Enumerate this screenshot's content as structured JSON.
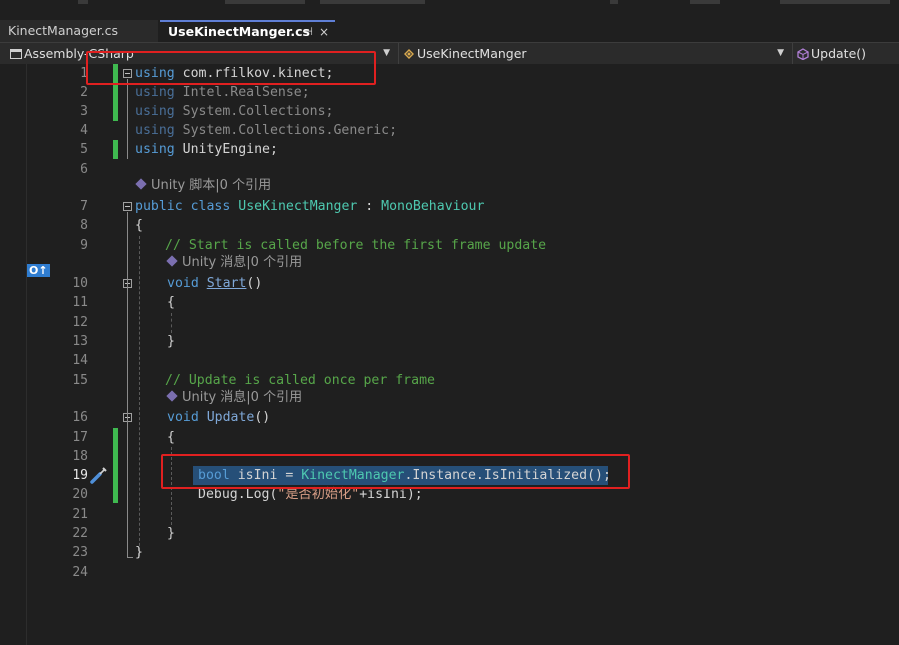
{
  "tabs": {
    "inactive_label": "KinectManager.cs",
    "active_label": "UseKinectManger.cs",
    "pin_glyph": "⊣",
    "close_glyph": "×"
  },
  "navbar": {
    "project": "Assembly-CSharp",
    "type": "UseKinectManger",
    "member": "Update()"
  },
  "editor": {
    "line_numbers": [
      "1",
      "2",
      "3",
      "4",
      "5",
      "6",
      "7",
      "8",
      "9",
      "10",
      "11",
      "12",
      "13",
      "14",
      "15",
      "16",
      "17",
      "18",
      "19",
      "20",
      "21",
      "22",
      "23",
      "24"
    ],
    "current_line": "19",
    "lines": {
      "l1": {
        "kw": "using",
        "rest": " com.rfilkov.kinect;"
      },
      "l2": {
        "kw": "using",
        "rest": " Intel.RealSense;"
      },
      "l3": {
        "kw": "using",
        "rest": " System.Collections;"
      },
      "l4": {
        "kw": "using",
        "rest": " System.Collections.Generic;"
      },
      "l5": {
        "kw": "using",
        "rest": " UnityEngine;"
      },
      "l7": {
        "kw1": "public",
        "kw2": "class",
        "name": "UseKinectManger",
        "sep": " : ",
        "base": "MonoBehaviour"
      },
      "l8": "{",
      "l9": "// Start is called before the first frame update",
      "l10": {
        "kw": "void",
        "name": "Start",
        "paren": "()"
      },
      "l11": "{",
      "l13": "}",
      "l15": "// Update is called once per frame",
      "l16": {
        "kw": "void",
        "name": "Update",
        "paren": "()"
      },
      "l17": "{",
      "l19": {
        "kw": "bool",
        "var": " isIni = ",
        "cls": "KinectManager",
        "rest": ".Instance.IsInitialized();"
      },
      "l20": {
        "a": "Debug.Log(",
        "str": "\"是否初始化\"",
        "b": "+isIni);"
      },
      "l22": "}",
      "l23": "}"
    },
    "codelens": {
      "class": "Unity 脚本|0 个引用",
      "start": "Unity 消息|0 个引用",
      "update": "Unity 消息|0 个引用"
    },
    "override_glyph": "O↑",
    "colors": {
      "keyword": "#569cd6",
      "type": "#4ec9b0",
      "comment": "#57a64a",
      "string": "#d69d85",
      "annotation": "#e02020",
      "change_bar": "#3fb950"
    }
  }
}
